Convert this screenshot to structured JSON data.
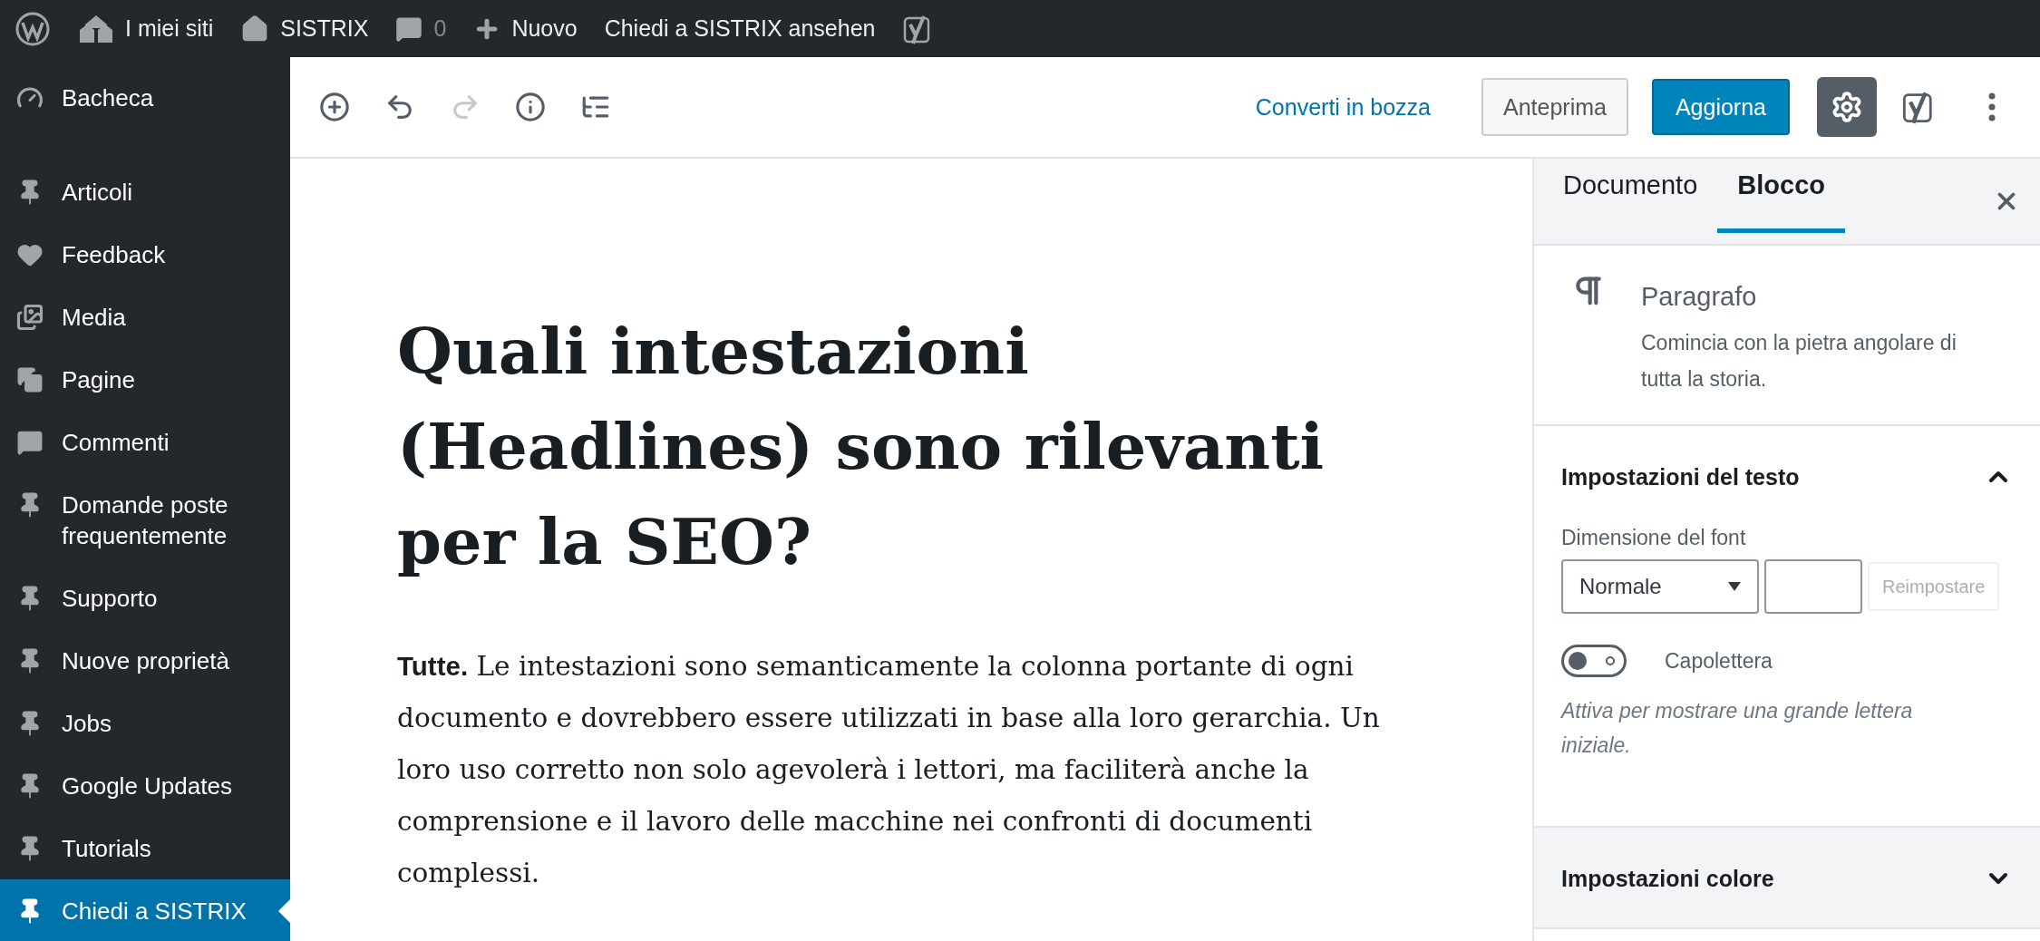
{
  "admin_bar": [
    {
      "kind": "wp"
    },
    {
      "kind": "sites",
      "label": "I miei siti"
    },
    {
      "kind": "home",
      "label": "SISTRIX"
    },
    {
      "kind": "comments",
      "label": "0"
    },
    {
      "kind": "new",
      "label": "Nuovo"
    },
    {
      "kind": "text",
      "label": "Chiedi a SISTRIX ansehen"
    },
    {
      "kind": "yoast"
    }
  ],
  "sidebar": {
    "items": [
      {
        "kind": "dashboard",
        "label": "Bacheca",
        "selected": false
      },
      {
        "kind": "pin",
        "label": "Articoli",
        "selected": false
      },
      {
        "kind": "heart",
        "label": "Feedback",
        "selected": false
      },
      {
        "kind": "media",
        "label": "Media",
        "selected": false
      },
      {
        "kind": "pages",
        "label": "Pagine",
        "selected": false
      },
      {
        "kind": "comments",
        "label": "Commenti",
        "selected": false
      },
      {
        "kind": "pin",
        "label": "Domande poste frequentemente",
        "selected": false
      },
      {
        "kind": "pin",
        "label": "Supporto",
        "selected": false
      },
      {
        "kind": "pin",
        "label": "Nuove proprietà",
        "selected": false
      },
      {
        "kind": "pin",
        "label": "Jobs",
        "selected": false
      },
      {
        "kind": "pin",
        "label": "Google Updates",
        "selected": false
      },
      {
        "kind": "pin",
        "label": "Tutorials",
        "selected": false
      },
      {
        "kind": "pin",
        "label": "Chiedi a SISTRIX",
        "selected": true
      }
    ]
  },
  "toolbar": {
    "tools": [
      {
        "kind": "add",
        "disabled": false
      },
      {
        "kind": "undo",
        "disabled": false
      },
      {
        "kind": "redo",
        "disabled": true
      },
      {
        "kind": "info",
        "disabled": false
      },
      {
        "kind": "outline",
        "disabled": false
      }
    ],
    "draft_link": "Converti in bozza",
    "preview": "Anteprima",
    "update": "Aggiorna",
    "settings_on": true
  },
  "editor": {
    "title": "Quali intestazioni (Headlines) sono rilevanti per la SEO?",
    "paragraph": "**Tutte.** Le intestazioni sono semanticamente la colonna portante di ogni documento e dovrebbero essere utilizzati in base alla loro gerarchia. Un loro uso corretto non solo agevolerà i lettori, ma faciliterà anche la comprensione e il lavoro delle macchine nei confronti di documenti complessi."
  },
  "settings_sidebar": {
    "tabs": [
      {
        "label": "Documento",
        "selected": false
      },
      {
        "label": "Blocco",
        "selected": true
      }
    ],
    "block": {
      "name": "Paragrafo",
      "description": "Comincia con la pietra angolare di tutta la storia."
    },
    "panels": [
      {
        "title": "Impostazioni del testo",
        "expanded": true,
        "font_size_label": "Dimensione del font",
        "font_size": "Normale",
        "reset": "Reimpostare",
        "reset_disabled": true,
        "drop_cap": {
          "label": "Capolettera",
          "on": false,
          "help": "Attiva per mostrare una grande lettera iniziale."
        }
      },
      {
        "title": "Impostazioni colore",
        "expanded": false
      }
    ]
  }
}
